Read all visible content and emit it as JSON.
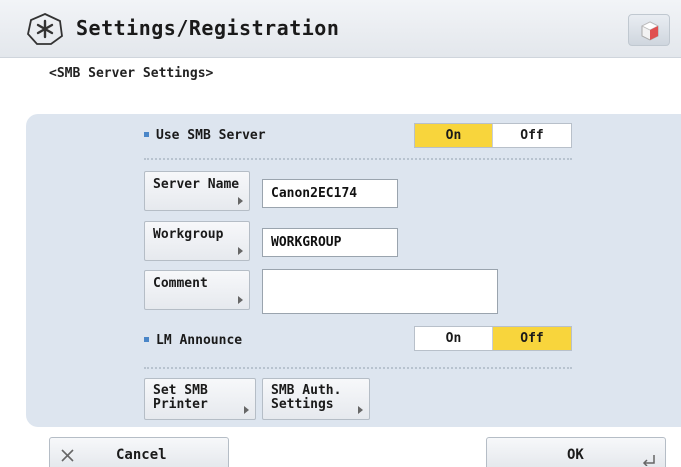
{
  "header": {
    "title": "Settings/Registration",
    "icon": "settings-star-icon",
    "right_button_icon": "cube-icon"
  },
  "breadcrumb": "<SMB Server Settings>",
  "use_smb_server": {
    "label": "Use SMB Server",
    "on_label": "On",
    "off_label": "Off",
    "selected": "On"
  },
  "server_name": {
    "button_label": "Server Name",
    "value": "Canon2EC174"
  },
  "workgroup": {
    "button_label": "Workgroup",
    "value": "WORKGROUP"
  },
  "comment": {
    "button_label": "Comment",
    "value": ""
  },
  "lm_announce": {
    "label": "LM Announce",
    "on_label": "On",
    "off_label": "Off",
    "selected": "Off"
  },
  "set_smb_printer": {
    "line1": "Set SMB",
    "line2": "Printer"
  },
  "smb_auth_settings": {
    "line1": "SMB Auth.",
    "line2": "Settings"
  },
  "footer": {
    "cancel_label": "Cancel",
    "cancel_icon": "close-icon",
    "ok_label": "OK",
    "ok_icon": "return-icon"
  },
  "colors": {
    "accent_selected": "#f8d53c",
    "panel_bg": "#dde5ef",
    "bullet": "#4a86c8"
  }
}
